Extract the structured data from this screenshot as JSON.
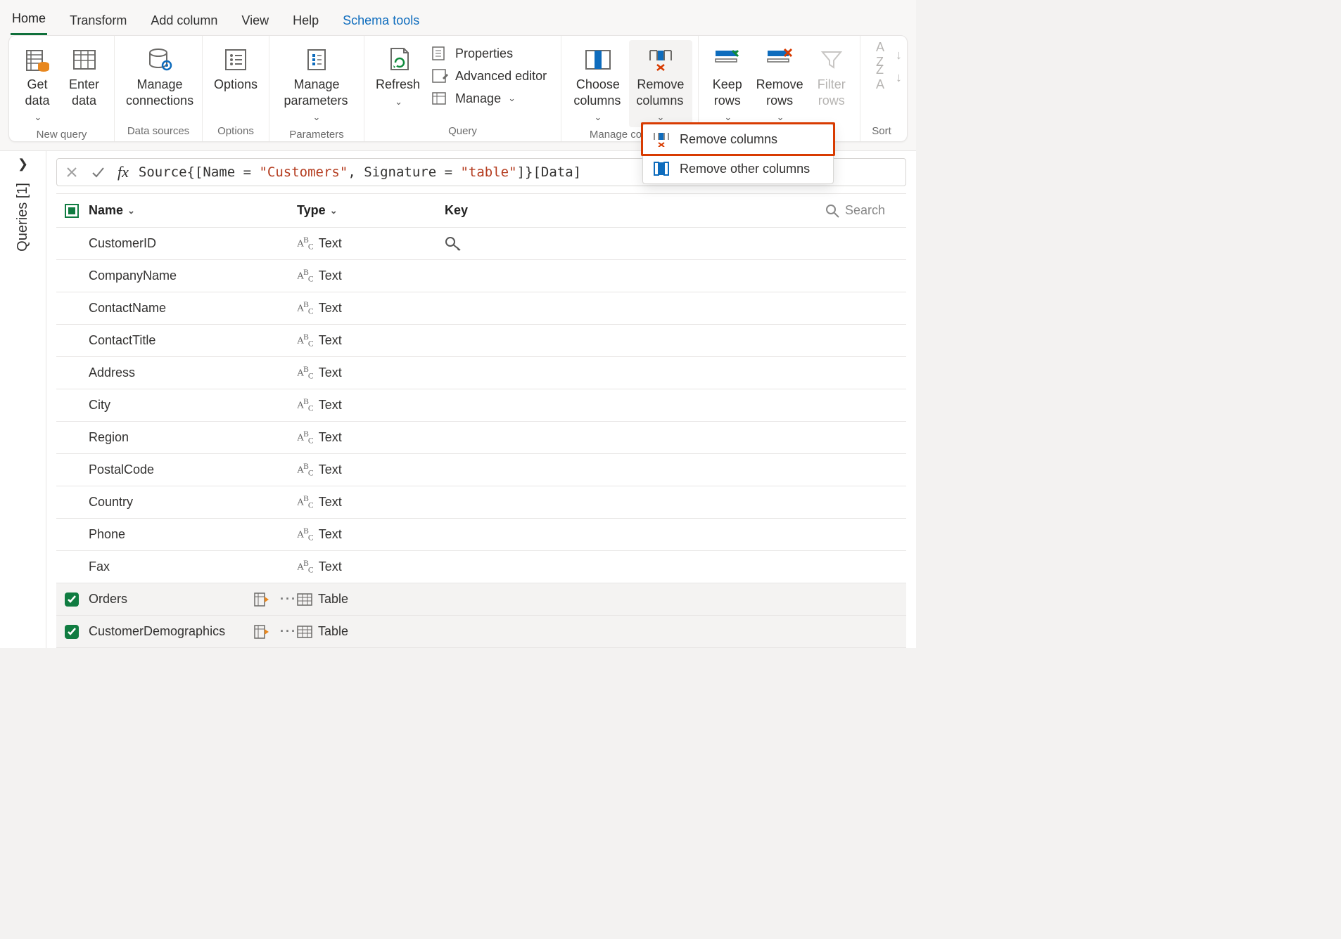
{
  "tabs": {
    "home": "Home",
    "transform": "Transform",
    "add_column": "Add column",
    "view": "View",
    "help": "Help",
    "schema_tools": "Schema tools"
  },
  "ribbon": {
    "new_query": {
      "label": "New query",
      "get_data": "Get data",
      "enter_data": "Enter data"
    },
    "data_sources": {
      "label": "Data sources",
      "manage_connections": "Manage connections"
    },
    "options_group": {
      "label": "Options",
      "options": "Options"
    },
    "parameters_group": {
      "label": "Parameters",
      "manage_parameters": "Manage parameters"
    },
    "query_group": {
      "label": "Query",
      "refresh": "Refresh",
      "properties": "Properties",
      "advanced_editor": "Advanced editor",
      "manage": "Manage"
    },
    "manage_columns_group": {
      "label": "Manage columns",
      "choose_columns": "Choose columns",
      "remove_columns": "Remove columns"
    },
    "reduce_rows_group": {
      "label": "",
      "keep_rows": "Keep rows",
      "remove_rows": "Remove rows",
      "filter_rows": "Filter rows"
    },
    "sort_group": {
      "label": "Sort"
    }
  },
  "menu": {
    "remove_columns": "Remove columns",
    "remove_other_columns": "Remove other columns"
  },
  "queries_pane": {
    "label": "Queries [1]"
  },
  "formula": {
    "pre": "Source{[Name = ",
    "s1": "\"Customers\"",
    "mid": ", Signature = ",
    "s2": "\"table\"",
    "post": "]}[Data]"
  },
  "grid": {
    "headers": {
      "name": "Name",
      "type": "Type",
      "key": "Key"
    },
    "search_placeholder": "Search",
    "type_text": "Text",
    "type_table": "Table",
    "rows": [
      {
        "name": "CustomerID",
        "type": "text",
        "key": true
      },
      {
        "name": "CompanyName",
        "type": "text"
      },
      {
        "name": "ContactName",
        "type": "text"
      },
      {
        "name": "ContactTitle",
        "type": "text"
      },
      {
        "name": "Address",
        "type": "text"
      },
      {
        "name": "City",
        "type": "text"
      },
      {
        "name": "Region",
        "type": "text"
      },
      {
        "name": "PostalCode",
        "type": "text"
      },
      {
        "name": "Country",
        "type": "text"
      },
      {
        "name": "Phone",
        "type": "text"
      },
      {
        "name": "Fax",
        "type": "text"
      },
      {
        "name": "Orders",
        "type": "table",
        "selected": true
      },
      {
        "name": "CustomerDemographics",
        "type": "table",
        "selected": true
      }
    ]
  }
}
